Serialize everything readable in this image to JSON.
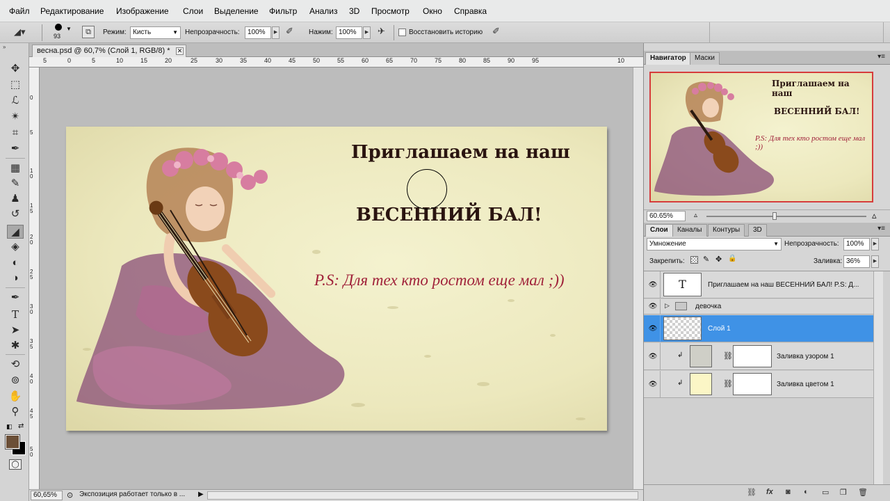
{
  "menu": [
    "Файл",
    "Редактирование",
    "Изображение",
    "Слои",
    "Выделение",
    "Фильтр",
    "Анализ",
    "3D",
    "Просмотр",
    "Окно",
    "Справка"
  ],
  "options": {
    "brush_size": "93",
    "mode_label": "Режим:",
    "mode_value": "Кисть",
    "opacity_label": "Непрозрачность:",
    "opacity_value": "100%",
    "pressure_label": "Нажим:",
    "pressure_value": "100%",
    "restore_history_label": "Восстановить историю"
  },
  "document": {
    "tab_title": "весна.psd @ 60,7% (Слой 1, RGB/8) *",
    "close_glyph": "✕",
    "ruler_top": [
      "5",
      "0",
      "5",
      "10",
      "15",
      "20",
      "25",
      "30",
      "35",
      "40",
      "45",
      "50",
      "55",
      "60",
      "65",
      "70",
      "75",
      "80",
      "85",
      "90",
      "95",
      "10"
    ],
    "ruler_left": [
      "0",
      "5",
      "1 0",
      "1 5",
      "2 0",
      "2 5",
      "3 0",
      "3 5",
      "4 0",
      "4 5",
      "5 0"
    ],
    "zoom_status": "60,65%",
    "status_text": "Экспозиция работает только в ..."
  },
  "artwork": {
    "line1": "Приглашаем на наш",
    "line2": "ВЕСЕННИЙ БАЛ!",
    "line3": "P.S: Для тех кто ростом еще мал ;))"
  },
  "navigator": {
    "tabs": [
      "Навигатор",
      "Маски"
    ],
    "zoom": "60.65%"
  },
  "layers_panel": {
    "tabs": [
      "Слои",
      "Каналы",
      "Контуры",
      "3D"
    ],
    "blend_mode": "Умножение",
    "opacity_label": "Непрозрачность:",
    "opacity_value": "100%",
    "lock_label": "Закрепить:",
    "fill_label": "Заливка:",
    "fill_value": "36%",
    "layers": [
      {
        "name": "Приглашаем на наш  ВЕСЕННИЙ БАЛ!  P.S: Д...",
        "kind": "text",
        "thumb_glyph": "T"
      },
      {
        "name": "девочка",
        "kind": "group"
      },
      {
        "name": "Слой 1",
        "kind": "pixel",
        "selected": true
      },
      {
        "name": "Заливка узором 1",
        "kind": "pattern-fill"
      },
      {
        "name": "Заливка цветом 1",
        "kind": "color-fill"
      }
    ]
  },
  "colors": {
    "foreground": "#6b4f37",
    "background": "#000000",
    "selection": "#3f92e6",
    "nav_frame": "#d63c3c",
    "title_text": "#2a1410",
    "ps_text": "#a0223a"
  }
}
